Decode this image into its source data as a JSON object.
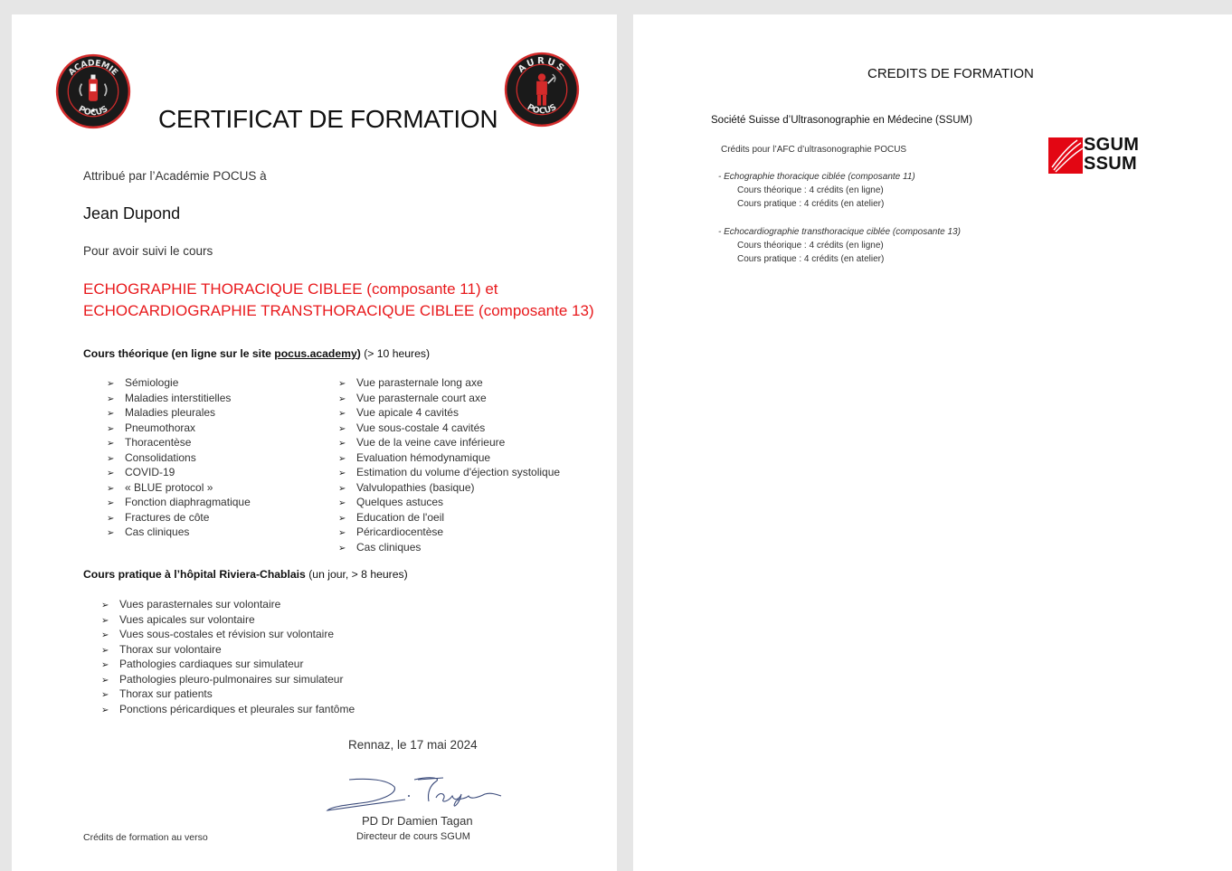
{
  "left_page": {
    "logo_left_text": "ACADEMIE POCUS",
    "logo_right_text": "AURUS POCUS",
    "title": "CERTIFICAT DE FORMATION",
    "attribution": "Attribué par l’Académie POCUS à",
    "recipient": "Jean Dupond",
    "followed": "Pour avoir suivi le cours",
    "course_line1": "ECHOGRAPHIE THORACIQUE CIBLEE (composante 11) et",
    "course_line2": "ECHOCARDIOGRAPHIE TRANSTHORACIQUE CIBLEE (composante 13)",
    "theory_heading_bold": "Cours théorique (en ligne sur le site ",
    "theory_heading_link": "pocus.academy",
    "theory_heading_close": ")",
    "theory_heading_rest": " (> 10 heures)",
    "theory_col1": [
      "Sémiologie",
      "Maladies interstitielles",
      "Maladies pleurales",
      "Pneumothorax",
      "Thoracentèse",
      "Consolidations",
      "COVID-19",
      "« BLUE protocol »",
      "Fonction diaphragmatique",
      "Fractures de côte",
      "Cas cliniques"
    ],
    "theory_col2": [
      "Vue parasternale long axe",
      "Vue parasternale court axe",
      "Vue apicale 4 cavités",
      "Vue sous-costale 4 cavités",
      "Vue de la veine cave inférieure",
      "Evaluation hémodynamique",
      "Estimation du volume d'éjection systolique",
      "Valvulopathies (basique)",
      "Quelques astuces",
      "Education de l'oeil",
      "Péricardiocentèse",
      "Cas cliniques"
    ],
    "practice_heading_bold": "Cours pratique à l’hôpital Riviera-Chablais",
    "practice_heading_rest": " (un jour, > 8 heures)",
    "practice_items": [
      "Vues parasternales sur volontaire",
      "Vues apicales sur volontaire",
      "Vues sous-costales et révision sur volontaire",
      "Thorax sur volontaire",
      "Pathologies cardiaques sur simulateur",
      "Pathologies pleuro-pulmonaires sur simulateur",
      "Thorax sur patients",
      "Ponctions péricardiques et pleurales sur fantôme"
    ],
    "date_line": "Rennaz, le 17 mai 2024",
    "signature": "D. Tagan",
    "signer_name": "PD Dr Damien Tagan",
    "signer_role": "Directeur de cours SGUM",
    "verso_note": "Crédits de formation au verso",
    "bullet": "➢"
  },
  "right_page": {
    "title": "CREDITS DE FORMATION",
    "society": "Société Suisse d’Ultrasonographie en Médecine (SSUM)",
    "credits_intro": "Crédits pour l’AFC d’ultrasonographie POCUS",
    "logo_line1": "SGUM",
    "logo_line2": "SSUM",
    "block1_title": "- Echographie thoracique ciblée (composante 11)",
    "block1_theory": "Cours théorique : 4 crédits (en ligne)",
    "block1_practice": "Cours pratique : 4 crédits (en atelier)",
    "block2_title": "- Echocardiographie transthoracique ciblée (composante 13)",
    "block2_theory": "Cours théorique : 4 crédits (en ligne)",
    "block2_practice": "Cours pratique : 4 crédits (en atelier)"
  },
  "colors": {
    "accent_red": "#e8191c",
    "logo_dark": "#1a1a1a",
    "logo_ring": "#d42b2b",
    "sgum_red": "#e30613"
  },
  "icons": [
    "academie-pocus-logo",
    "aurus-pocus-logo",
    "sgum-logo",
    "bullet-arrow-icon"
  ]
}
